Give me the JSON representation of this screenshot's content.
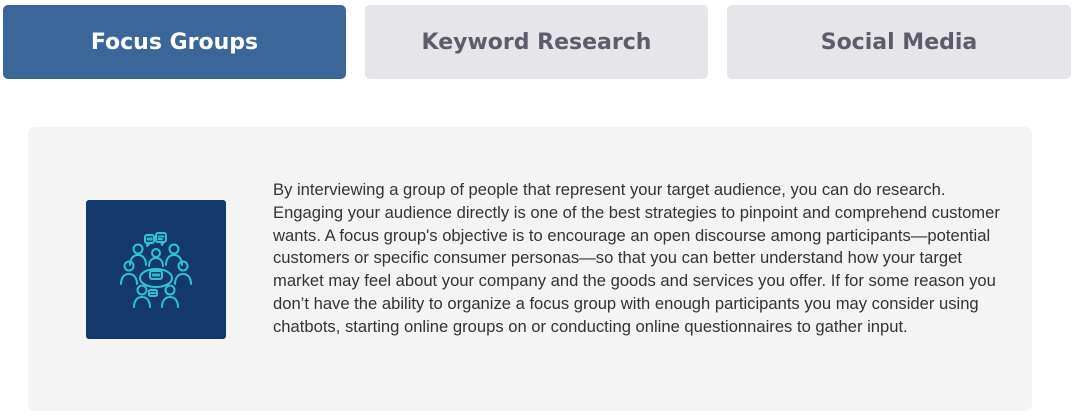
{
  "tabs": [
    {
      "label": "Focus Groups",
      "active": true
    },
    {
      "label": "Keyword Research",
      "active": false
    },
    {
      "label": "Social Media",
      "active": false
    }
  ],
  "panel": {
    "icon": "focus-group-icon",
    "text": "By interviewing a group of people that represent your target audience, you can do research. Engaging your audience directly is one of the best strategies to pinpoint and comprehend customer wants. A focus group's objective is to encourage an open discourse among participants—potential customers or specific consumer personas—so that you can better understand how your target market may feel about your company and the goods and services you offer. If for some reason you don’t have the ability to organize a focus group with enough participants you may consider using chatbots, starting online groups on or conducting online questionnaires to gather input."
  },
  "colors": {
    "active_tab": "#3a6699",
    "inactive_tab": "#e6e5ea",
    "inactive_text": "#5e5c6b",
    "panel_bg": "#f4f4f4",
    "icon_bg": "#13386b",
    "icon_stroke": "#2ec4d6"
  }
}
